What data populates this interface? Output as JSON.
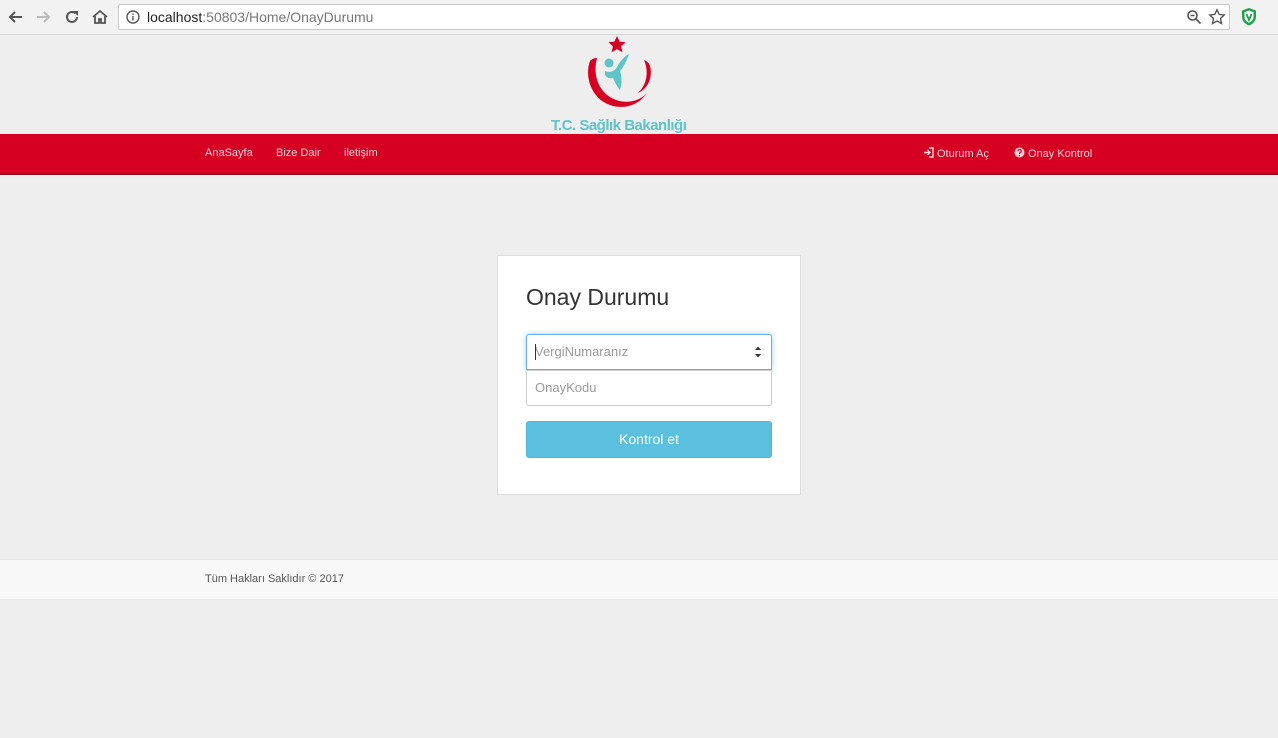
{
  "browser": {
    "url_host": "localhost",
    "url_rest": ":50803/Home/OnayDurumu"
  },
  "header": {
    "logo_text": "T.C. Sağlık Bakanlığı"
  },
  "navbar": {
    "left_links": [
      "AnaSayfa",
      "Bize Dair",
      "iletişim"
    ],
    "right_links": [
      {
        "label": "Oturum Aç",
        "icon": "login-icon"
      },
      {
        "label": "Onay Kontrol",
        "icon": "question-circle-icon"
      }
    ]
  },
  "panel": {
    "title": "Onay Durumu",
    "tax_number_placeholder": "VergiNumaranız",
    "approval_code_placeholder": "OnayKodu",
    "submit_label": "Kontrol et"
  },
  "footer": {
    "text": "Tüm Hakları Saklıdır © 2017"
  },
  "colors": {
    "navbar": "#d60022",
    "button": "#5bc0de",
    "logo_teal": "#5fc4c8"
  }
}
